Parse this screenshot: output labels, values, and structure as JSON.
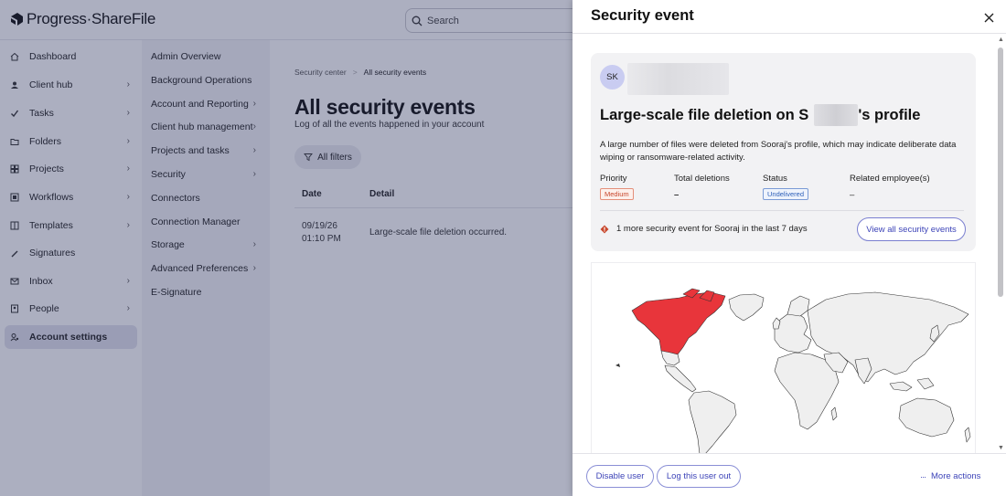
{
  "app": {
    "logo_text": "Progress·ShareFile",
    "search_placeholder": "Search"
  },
  "sidebar": {
    "items": [
      {
        "label": "Dashboard",
        "icon": "home-icon",
        "has_chevron": false
      },
      {
        "label": "Client hub",
        "icon": "client-hub-icon",
        "has_chevron": true
      },
      {
        "label": "Tasks",
        "icon": "tasks-icon",
        "has_chevron": true
      },
      {
        "label": "Folders",
        "icon": "folder-icon",
        "has_chevron": true
      },
      {
        "label": "Projects",
        "icon": "projects-icon",
        "has_chevron": true
      },
      {
        "label": "Workflows",
        "icon": "workflows-icon",
        "has_chevron": true
      },
      {
        "label": "Templates",
        "icon": "templates-icon",
        "has_chevron": true
      },
      {
        "label": "Signatures",
        "icon": "signature-icon",
        "has_chevron": false
      },
      {
        "label": "Inbox",
        "icon": "inbox-icon",
        "has_chevron": true
      },
      {
        "label": "People",
        "icon": "people-icon",
        "has_chevron": true
      },
      {
        "label": "Account settings",
        "icon": "account-settings-icon",
        "has_chevron": false,
        "active": true
      }
    ]
  },
  "subnav": {
    "items": [
      {
        "label": "Admin Overview",
        "has_chevron": false
      },
      {
        "label": "Background Operations",
        "has_chevron": false
      },
      {
        "label": "Account and Reporting",
        "has_chevron": true
      },
      {
        "label": "Client hub management",
        "has_chevron": true
      },
      {
        "label": "Projects and tasks",
        "has_chevron": true
      },
      {
        "label": "Security",
        "has_chevron": true
      },
      {
        "label": "Connectors",
        "has_chevron": false
      },
      {
        "label": "Connection Manager",
        "has_chevron": false
      },
      {
        "label": "Storage",
        "has_chevron": true
      },
      {
        "label": "Advanced Preferences",
        "has_chevron": true
      },
      {
        "label": "E-Signature",
        "has_chevron": false
      }
    ]
  },
  "main": {
    "breadcrumb": [
      "Security center",
      ">",
      "All security events"
    ],
    "title": "All security events",
    "subtitle": "Log of all the events happened in your account",
    "filters_label": "All filters",
    "columns": [
      "Date",
      "Detail"
    ],
    "rows": [
      {
        "date": "09/19/26",
        "time": "01:10 PM",
        "detail": "Large-scale file deletion occurred."
      }
    ]
  },
  "drawer": {
    "title": "Security event",
    "avatar_initials": "SK",
    "event_title_prefix": "Large-scale file deletion on S",
    "event_title_suffix": "'s profile",
    "description": "A large number of files were deleted from Sooraj's profile, which may indicate deliberate data wiping or ransomware-related activity.",
    "meta": {
      "priority_label": "Priority",
      "priority_value": "Medium",
      "deletions_label": "Total deletions",
      "deletions_value": "–",
      "status_label": "Status",
      "status_value": "Undelivered",
      "employees_label": "Related employee(s)",
      "employees_value": "–"
    },
    "more_events_text": "1 more security event for Sooraj in the last 7 days",
    "view_all_label": "View all security events",
    "footer": {
      "disable_user": "Disable user",
      "log_out_user": "Log this user out",
      "more_actions": "More actions"
    }
  },
  "colors": {
    "accent": "#3d44b8",
    "overlay": "#262c5a",
    "map_highlight": "#e8353b",
    "map_land": "#efefef",
    "priority_medium": "#c8472c",
    "status_undelivered": "#2c5fb8"
  }
}
